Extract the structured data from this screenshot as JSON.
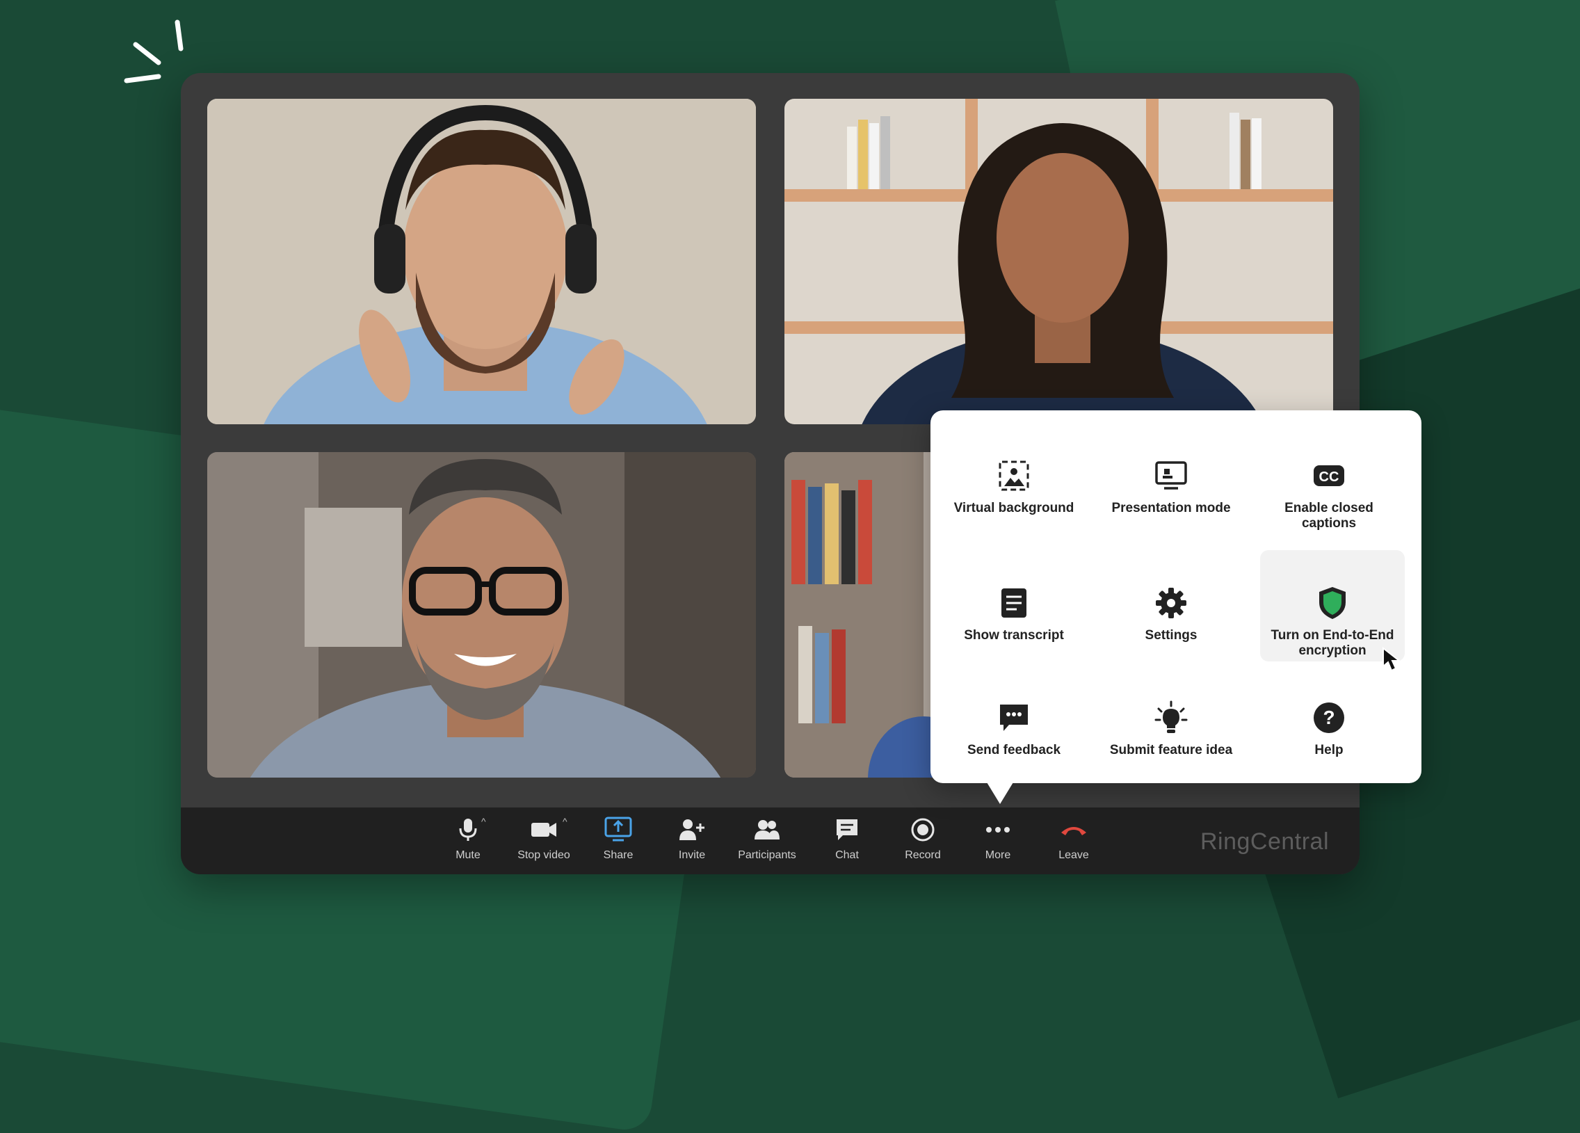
{
  "brand": "RingCentral",
  "toolbar": {
    "mute": "Mute",
    "stop_video": "Stop video",
    "share": "Share",
    "invite": "Invite",
    "participants": "Participants",
    "chat": "Chat",
    "record": "Record",
    "more": "More",
    "leave": "Leave"
  },
  "more_menu": {
    "items": [
      {
        "label": "Virtual background",
        "icon": "virtual-background-icon"
      },
      {
        "label": "Presentation mode",
        "icon": "presentation-icon"
      },
      {
        "label": "Enable closed captions",
        "icon": "closed-captions-icon"
      },
      {
        "label": "Show transcript",
        "icon": "transcript-icon"
      },
      {
        "label": "Settings",
        "icon": "gear-icon"
      },
      {
        "label": "Turn on End-to-End encryption",
        "icon": "shield-icon"
      },
      {
        "label": "Send feedback",
        "icon": "feedback-icon"
      },
      {
        "label": "Submit feature idea",
        "icon": "lightbulb-icon"
      },
      {
        "label": "Help",
        "icon": "help-icon"
      }
    ]
  },
  "colors": {
    "background": "#1a4a36",
    "share_accent": "#4aa3e8",
    "leave_red": "#e0483e",
    "shield_green": "#2fae5b"
  }
}
